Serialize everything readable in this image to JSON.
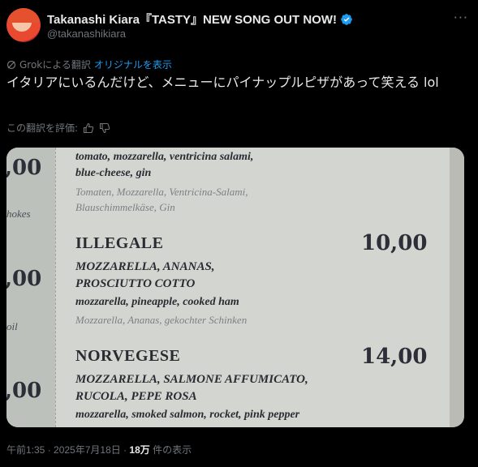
{
  "author": {
    "name": "Takanashi Kiara『TASTY』NEW SONG OUT NOW!",
    "handle": "@takanashikiara"
  },
  "translation": {
    "label": "Grokによる翻訳",
    "show_original": "オリジナルを表示",
    "rate_label": "この翻訳を評価:"
  },
  "tweet": {
    "text": "イタリアにいるんだけど、メニューにパイナップルピザがあって笑える lol"
  },
  "photo": {
    "left_column": [
      ",00",
      "hokes",
      ",00",
      "oil",
      ",00"
    ],
    "top_item": {
      "desc_it": "tomato, mozzarella, ventricina salami,",
      "desc_it_2": "blue-cheese, gin",
      "desc_de": "Tomaten, Mozzarella, Ventricina-Salami,",
      "desc_de_2": "Blauschimmelkäse, Gin"
    },
    "items": [
      {
        "name": "ILLEGALE",
        "price": "10,00",
        "ingredients_1": "MOZZARELLA, ANANAS,",
        "ingredients_2": "PROSCIUTTO COTTO",
        "english": "mozzarella, pineapple, cooked ham",
        "german": "Mozzarella, Ananas, gekochter Schinken"
      },
      {
        "name": "NORVEGESE",
        "price": "14,00",
        "ingredients_1": "MOZZARELLA, SALMONE AFFUMICATO,",
        "ingredients_2": "RUCOLA, PEPE ROSA",
        "english": "mozzarella, smoked salmon, rocket, pink pepper"
      }
    ]
  },
  "meta": {
    "time": "午前1:35 · 2025年7月18日 ·",
    "views": "18万",
    "views_suffix": "件の表示"
  },
  "icons": {
    "verified": "verified-badge-icon",
    "more": "more-options-icon",
    "grok": "grok-icon",
    "thumbs_up": "thumbs-up-icon",
    "thumbs_down": "thumbs-down-icon"
  },
  "colors": {
    "background": "#000000",
    "accent": "#1d9bf0",
    "text": "#e7e9ea",
    "muted": "#71767b"
  }
}
